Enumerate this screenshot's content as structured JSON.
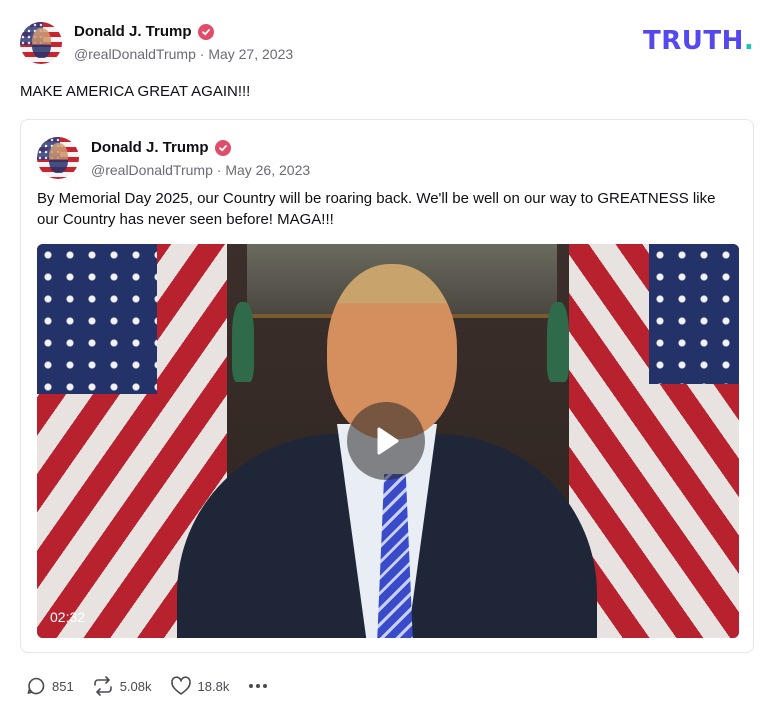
{
  "post": {
    "author_name": "Donald J. Trump",
    "handle": "@realDonaldTrump",
    "date": "May 27, 2023",
    "text": "MAKE AMERICA GREAT AGAIN!!!"
  },
  "brand": {
    "logo_text": "TRUTH",
    "logo_dot": ".",
    "primary_color": "#5448ee",
    "dot_color": "#18c5b0"
  },
  "quote": {
    "author_name": "Donald J. Trump",
    "handle": "@realDonaldTrump",
    "date": "May 26, 2023",
    "text": "By Memorial Day 2025, our Country will be roaring back. We'll be well on our way to GREATNESS like our Country has never seen before! MAGA!!!",
    "video": {
      "duration": "02:32",
      "play_icon": "play-icon"
    }
  },
  "actions": {
    "replies": "851",
    "retruths": "5.08k",
    "likes": "18.8k"
  },
  "separator": "·",
  "verified_color": "#e24c6b"
}
